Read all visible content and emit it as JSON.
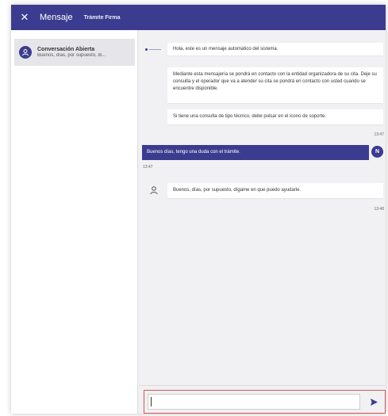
{
  "header": {
    "close_icon": "close-icon",
    "title": "Mensaje",
    "subtitle": "Trámite Firma",
    "color": "#3b3c8f"
  },
  "sidebar": {
    "conversation": {
      "avatar_icon": "agent-icon",
      "title": "Conversación Abierta",
      "preview": "Buenos, días, por supuesto, dí..."
    }
  },
  "messages": {
    "system": [
      "Hola, este es un mensaje automático del sistema.",
      "Mediante esta mensajería se pondrá en contacto con la entidad organizadora de su cita. Deje su consulta y el operador que va a atender su cita se pondrá en contacto con usted cuando se encuentre disponible.",
      "Si tiene una consulta de tipo técnico, debe pulsar en el icono de soporte."
    ],
    "system_time": "13:47",
    "user_message": "Buenos días, tengo una duda con el trámite.",
    "user_initial": "N",
    "user_time": "13:47",
    "agent_message": "Buenos, días, por supuesto, dígame en que puedo ayudarle.",
    "agent_time": "13:48"
  },
  "compose": {
    "value": "",
    "placeholder": "",
    "send_icon": "send-icon",
    "highlight_color": "#d9534f"
  }
}
